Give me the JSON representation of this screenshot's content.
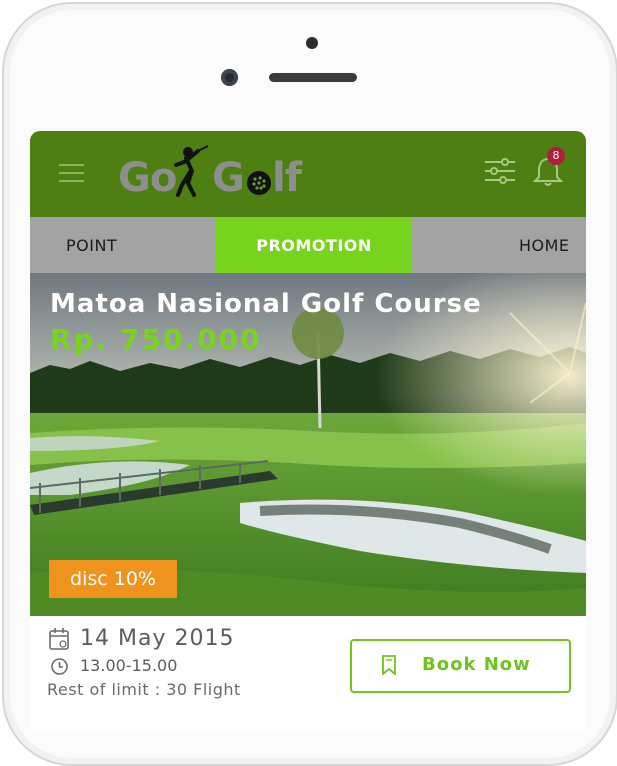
{
  "app": {
    "logo_text_1": "Go",
    "logo_text_2": "G",
    "logo_text_3": "lf",
    "notification_count": "8"
  },
  "tabs": [
    {
      "label": "POINT"
    },
    {
      "label": "PROMOTION"
    },
    {
      "label": "HOME"
    }
  ],
  "promo": {
    "title": "Matoa Nasional Golf Course",
    "price": "Rp. 750.000",
    "discount": "disc 10%",
    "date": "14 May 2015",
    "time": "13.00-15.00",
    "rest": "Rest of limit : 30 Flight",
    "book_label": "Book Now"
  },
  "colors": {
    "header": "#4e7f12",
    "accent": "#78d31e",
    "discount": "#f0931e",
    "badge": "#b21d3b"
  },
  "icons": [
    "menu-icon",
    "filter-icon",
    "bell-icon",
    "calendar-icon",
    "clock-icon",
    "bookmark-icon",
    "golfer-icon",
    "golf-ball-icon"
  ]
}
